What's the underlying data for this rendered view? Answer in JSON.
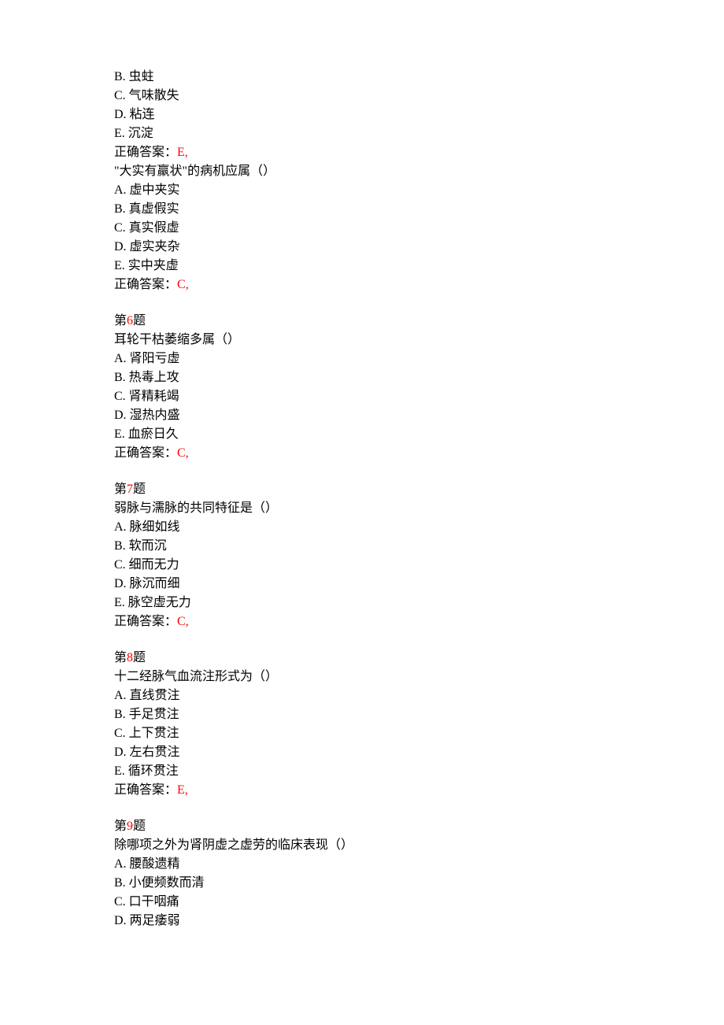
{
  "labels": {
    "answer_prefix": "正确答案：",
    "question_prefix": "第",
    "question_suffix": "题"
  },
  "leading_options": [
    "B. 虫蛀",
    "C. 气味散失",
    "D. 粘连",
    "E. 沉淀"
  ],
  "leading_answer": "E,",
  "inline_question": {
    "stem": "\"大实有羸状\"的病机应属（）",
    "options": [
      "A. 虚中夹实",
      "B. 真虚假实",
      "C. 真实假虚",
      "D. 虚实夹杂",
      "E. 实中夹虚"
    ],
    "answer": "C,"
  },
  "questions": [
    {
      "number": "6",
      "stem": "耳轮干枯萎缩多属（）",
      "options": [
        "A. 肾阳亏虚",
        "B. 热毒上攻",
        "C. 肾精耗竭",
        "D. 湿热内盛",
        "E. 血瘀日久"
      ],
      "answer": "C,"
    },
    {
      "number": "7",
      "stem": "弱脉与濡脉的共同特征是（）",
      "options": [
        "A. 脉细如线",
        "B. 软而沉",
        "C. 细而无力",
        "D. 脉沉而细",
        "E. 脉空虚无力"
      ],
      "answer": "C,"
    },
    {
      "number": "8",
      "stem": "十二经脉气血流注形式为（）",
      "options": [
        "A. 直线贯注",
        "B. 手足贯注",
        "C. 上下贯注",
        "D. 左右贯注",
        "E. 循环贯注"
      ],
      "answer": "E,"
    },
    {
      "number": "9",
      "stem": "除哪项之外为肾阴虚之虚劳的临床表现（）",
      "options": [
        "A. 腰酸遗精",
        "B. 小便频数而清",
        "C. 口干咽痛",
        "D. 两足痿弱"
      ],
      "answer": ""
    }
  ]
}
